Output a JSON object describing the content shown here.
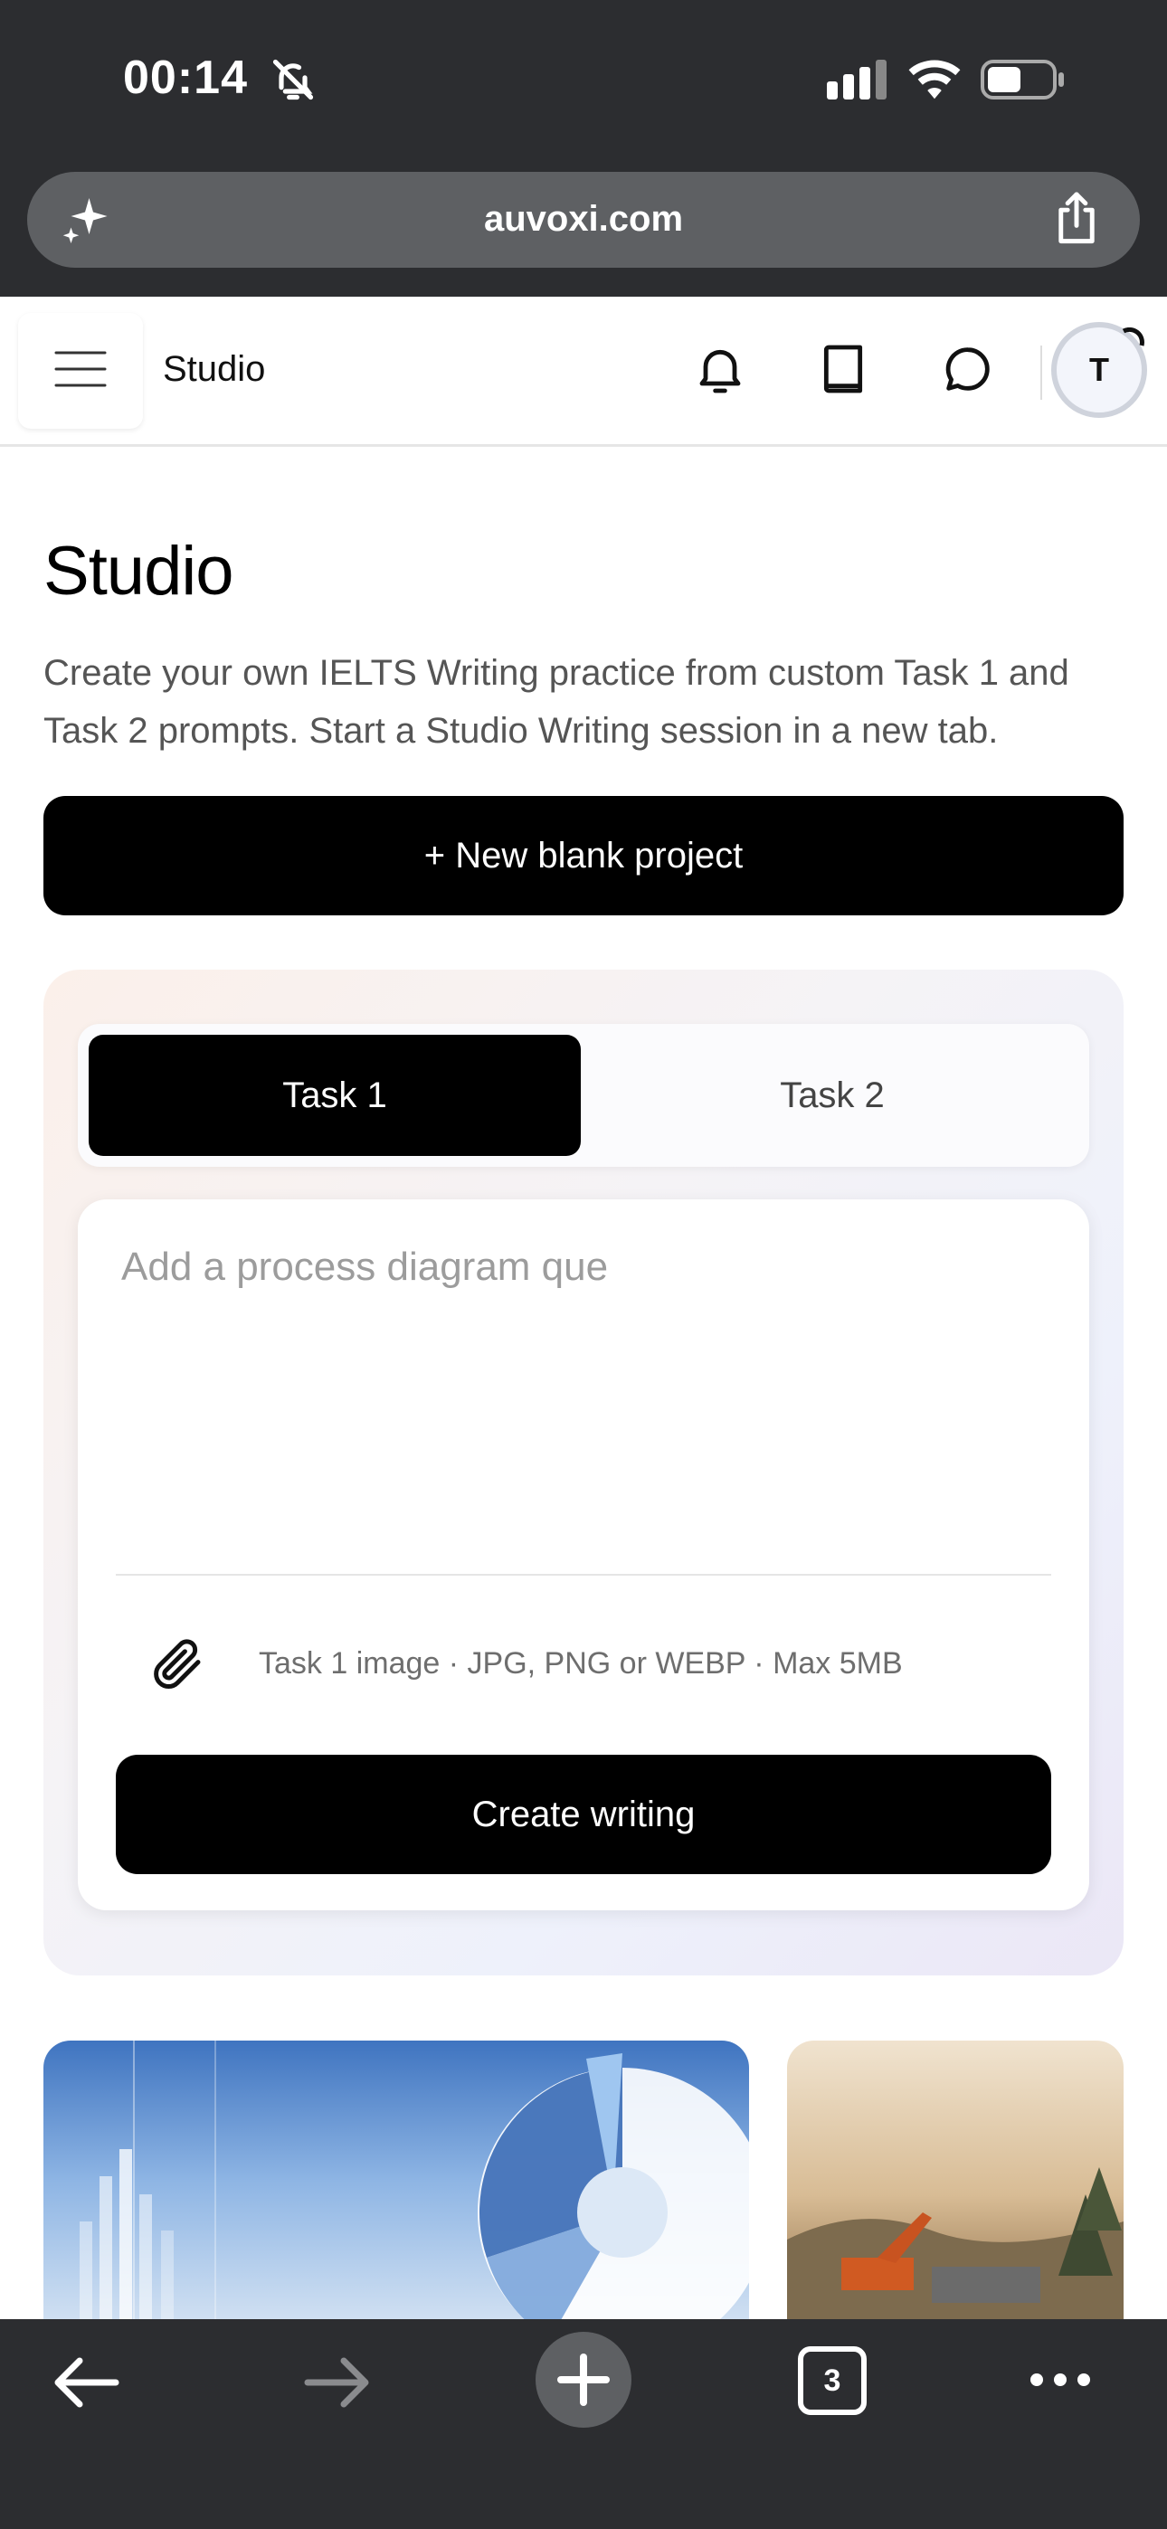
{
  "status_bar": {
    "time": "00:14"
  },
  "browser": {
    "url": "auvoxi.com",
    "tab_count": "3"
  },
  "header": {
    "title": "Studio",
    "avatar_initial": "T"
  },
  "main": {
    "title": "Studio",
    "description": "Create your own IELTS Writing practice from custom Task 1 and Task 2 prompts. Start a Studio Writing session in a new tab.",
    "new_project_label": "+ New blank project",
    "tabs": [
      {
        "label": "Task 1",
        "active": true
      },
      {
        "label": "Task 2",
        "active": false
      }
    ],
    "prompt": {
      "value": "",
      "placeholder": "Add a process diagram que"
    },
    "attachment_hint": "Task 1 image · JPG, PNG or WEBP · Max 5MB",
    "create_label": "Create writing"
  },
  "colors": {
    "chrome": "#2c2d30",
    "primary_button": "#000000",
    "muted_text": "#555555"
  }
}
